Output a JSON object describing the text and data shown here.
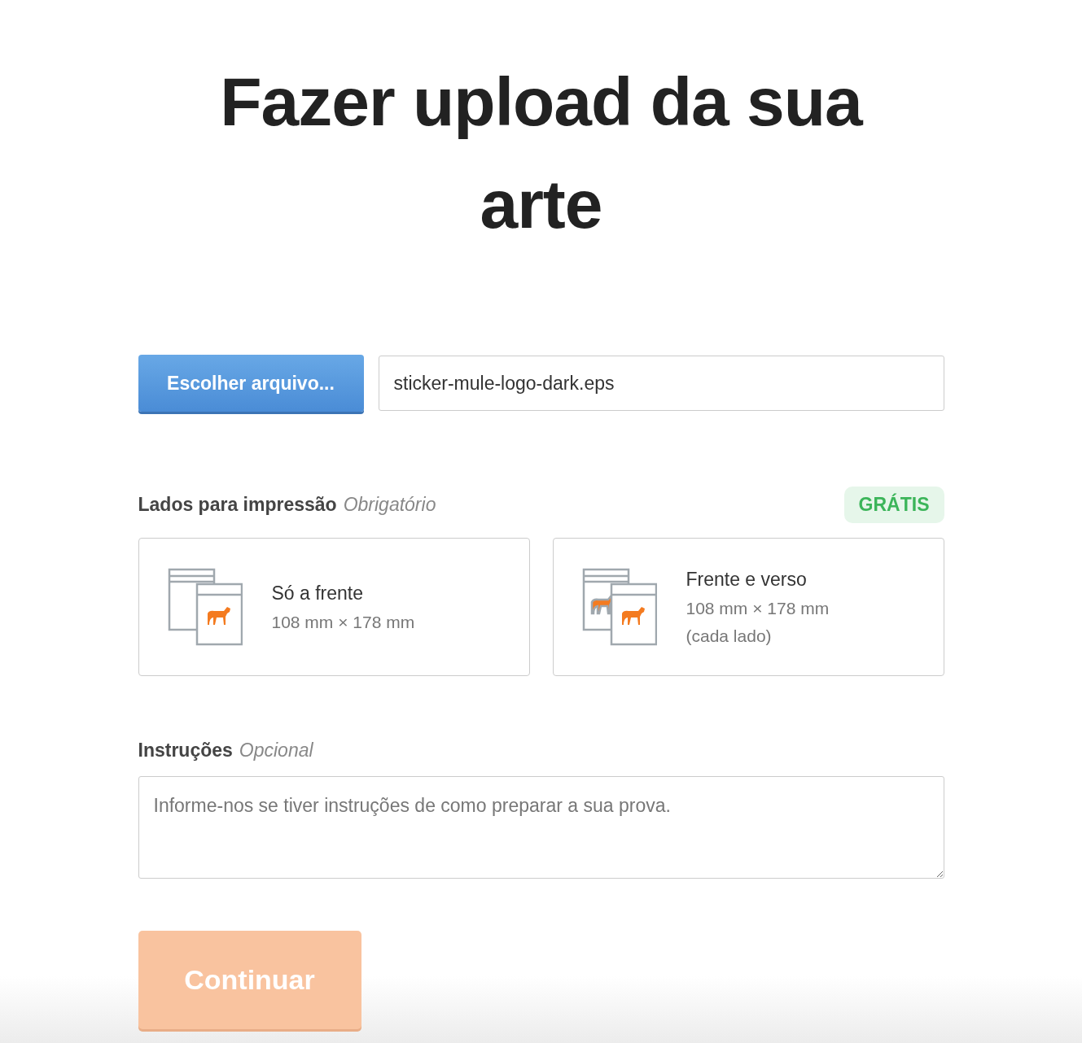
{
  "title": "Fazer upload da sua arte",
  "file": {
    "button": "Escolher arquivo...",
    "value": "sticker-mule-logo-dark.eps"
  },
  "sides": {
    "label": "Lados para impressão",
    "hint": "Obrigatório",
    "badge": "GRÁTIS",
    "options": [
      {
        "kind": "single",
        "title": "Só a frente",
        "lines": [
          "108 mm × 178 mm"
        ]
      },
      {
        "kind": "double",
        "title": "Frente e verso",
        "lines": [
          "108 mm × 178 mm",
          "(cada lado)"
        ]
      }
    ]
  },
  "instructions": {
    "label": "Instruções",
    "hint": "Opcional",
    "placeholder": "Informe-nos se tiver instruções de como preparar a sua prova."
  },
  "continue": {
    "label": "Continuar",
    "disabled": true
  }
}
